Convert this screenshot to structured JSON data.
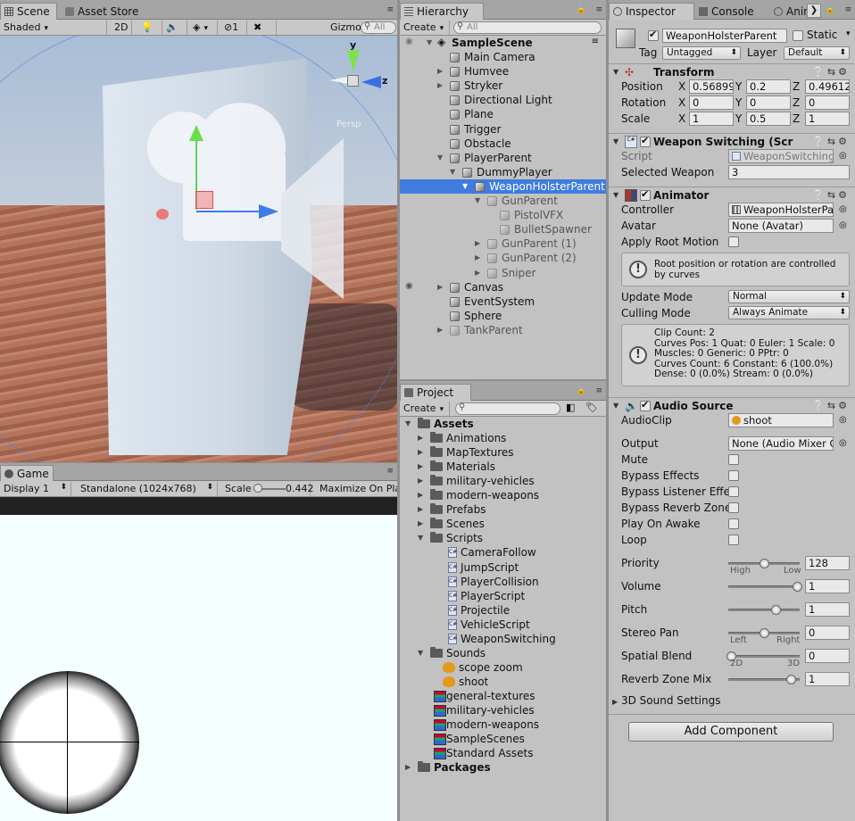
{
  "scene": {
    "tabs": [
      "Scene",
      "Asset Store"
    ],
    "toolbar": {
      "shading": "Shaded",
      "mode2d": "2D",
      "hidden_count": "1",
      "gizmos": "Gizmos",
      "search": "All"
    },
    "gizmo": {
      "y": "y",
      "z": "z",
      "persp": "Persp"
    }
  },
  "game": {
    "tab": "Game",
    "toolbar": {
      "display": "Display 1",
      "resolution": "Standalone (1024x768)",
      "scale_label": "Scale",
      "scale_value": "0.442",
      "maximize": "Maximize On Play"
    }
  },
  "hierarchy": {
    "tab": "Hierarchy",
    "create": "Create",
    "search": "All",
    "scene_name": "SampleScene",
    "items": [
      {
        "label": "Main Camera",
        "arrow": ""
      },
      {
        "label": "Humvee",
        "arrow": "▶"
      },
      {
        "label": "Stryker",
        "arrow": "▶"
      },
      {
        "label": "Directional Light",
        "arrow": ""
      },
      {
        "label": "Plane",
        "arrow": ""
      },
      {
        "label": "Trigger",
        "arrow": ""
      },
      {
        "label": "Obstacle",
        "arrow": ""
      },
      {
        "label": "PlayerParent",
        "arrow": "▼"
      },
      {
        "label": "DummyPlayer",
        "arrow": "▼"
      },
      {
        "label": "WeaponHolsterParent",
        "arrow": "▼"
      },
      {
        "label": "GunParent",
        "arrow": "▼"
      },
      {
        "label": "PistolVFX",
        "arrow": ""
      },
      {
        "label": "BulletSpawner",
        "arrow": ""
      },
      {
        "label": "GunParent (1)",
        "arrow": "▶"
      },
      {
        "label": "GunParent (2)",
        "arrow": "▶"
      },
      {
        "label": "Sniper",
        "arrow": "▶"
      },
      {
        "label": "Canvas",
        "arrow": "▶"
      },
      {
        "label": "EventSystem",
        "arrow": ""
      },
      {
        "label": "Sphere",
        "arrow": ""
      },
      {
        "label": "TankParent",
        "arrow": "▶"
      }
    ]
  },
  "project": {
    "tab": "Project",
    "create": "Create",
    "items": [
      {
        "label": "Assets"
      },
      {
        "label": "Animations"
      },
      {
        "label": "MapTextures"
      },
      {
        "label": "Materials"
      },
      {
        "label": "military-vehicles"
      },
      {
        "label": "modern-weapons"
      },
      {
        "label": "Prefabs"
      },
      {
        "label": "Scenes"
      },
      {
        "label": "Scripts"
      },
      {
        "label": "CameraFollow"
      },
      {
        "label": "JumpScript"
      },
      {
        "label": "PlayerCollision"
      },
      {
        "label": "PlayerScript"
      },
      {
        "label": "Projectile"
      },
      {
        "label": "VehicleScript"
      },
      {
        "label": "WeaponSwitching"
      },
      {
        "label": "Sounds"
      },
      {
        "label": "scope zoom"
      },
      {
        "label": "shoot"
      },
      {
        "label": "general-textures"
      },
      {
        "label": "military-vehicles"
      },
      {
        "label": "modern-weapons"
      },
      {
        "label": "SampleScenes"
      },
      {
        "label": "Standard Assets"
      },
      {
        "label": "Packages"
      }
    ]
  },
  "inspector": {
    "tabs": [
      "Inspector",
      "Console",
      "Anim"
    ],
    "object_name": "WeaponHolsterParent",
    "static_label": "Static",
    "tag_label": "Tag",
    "tag_value": "Untagged",
    "layer_label": "Layer",
    "layer_value": "Default",
    "transform": {
      "title": "Transform",
      "position_label": "Position",
      "rotation_label": "Rotation",
      "scale_label": "Scale",
      "position": [
        "0.56899",
        "0.2",
        "0.49612"
      ],
      "rotation": [
        "0",
        "0",
        "0"
      ],
      "scale": [
        "1",
        "0.5",
        "1"
      ],
      "axes": [
        "X",
        "Y",
        "Z"
      ]
    },
    "weapon_switching": {
      "title": "Weapon Switching (Scr",
      "script_label": "Script",
      "script_value": "WeaponSwitching",
      "selected_label": "Selected Weapon",
      "selected_value": "3"
    },
    "animator": {
      "title": "Animator",
      "controller_label": "Controller",
      "controller_value": "WeaponHolsterPar",
      "avatar_label": "Avatar",
      "avatar_value": "None (Avatar)",
      "root_motion_label": "Apply Root Motion",
      "info1": "Root position or rotation are controlled by curves",
      "update_label": "Update Mode",
      "update_value": "Normal",
      "culling_label": "Culling Mode",
      "culling_value": "Always Animate",
      "clip_info": [
        "Clip Count: 2",
        "Curves Pos: 1 Quat: 0 Euler: 1 Scale: 0",
        "Muscles: 0 Generic: 0 PPtr: 0",
        "Curves Count: 6 Constant: 6 (100.0%)",
        "Dense: 0 (0.0%) Stream: 0 (0.0%)"
      ]
    },
    "audio": {
      "title": "Audio Source",
      "clip_label": "AudioClip",
      "clip_value": "shoot",
      "output_label": "Output",
      "output_value": "None (Audio Mixer G",
      "mute": "Mute",
      "bypass_effects": "Bypass Effects",
      "bypass_listener": "Bypass Listener Effe",
      "bypass_reverb": "Bypass Reverb Zone",
      "play_on_awake": "Play On Awake",
      "loop": "Loop",
      "priority_label": "Priority",
      "priority_value": "128",
      "priority_high": "High",
      "priority_low": "Low",
      "priority_level": 0.5,
      "volume_label": "Volume",
      "volume_value": "1",
      "volume_level": 1.0,
      "pitch_label": "Pitch",
      "pitch_value": "1",
      "pitch_level": 0.67,
      "stereo_label": "Stereo Pan",
      "stereo_value": "0",
      "stereo_left": "Left",
      "stereo_right": "Right",
      "stereo_level": 0.5,
      "spatial_label": "Spatial Blend",
      "spatial_value": "0",
      "spatial_2d": "2D",
      "spatial_3d": "3D",
      "spatial_level": 0.0,
      "reverb_label": "Reverb Zone Mix",
      "reverb_value": "1",
      "reverb_level": 0.91,
      "sound_settings": "3D Sound Settings"
    },
    "add_component": "Add Component"
  }
}
